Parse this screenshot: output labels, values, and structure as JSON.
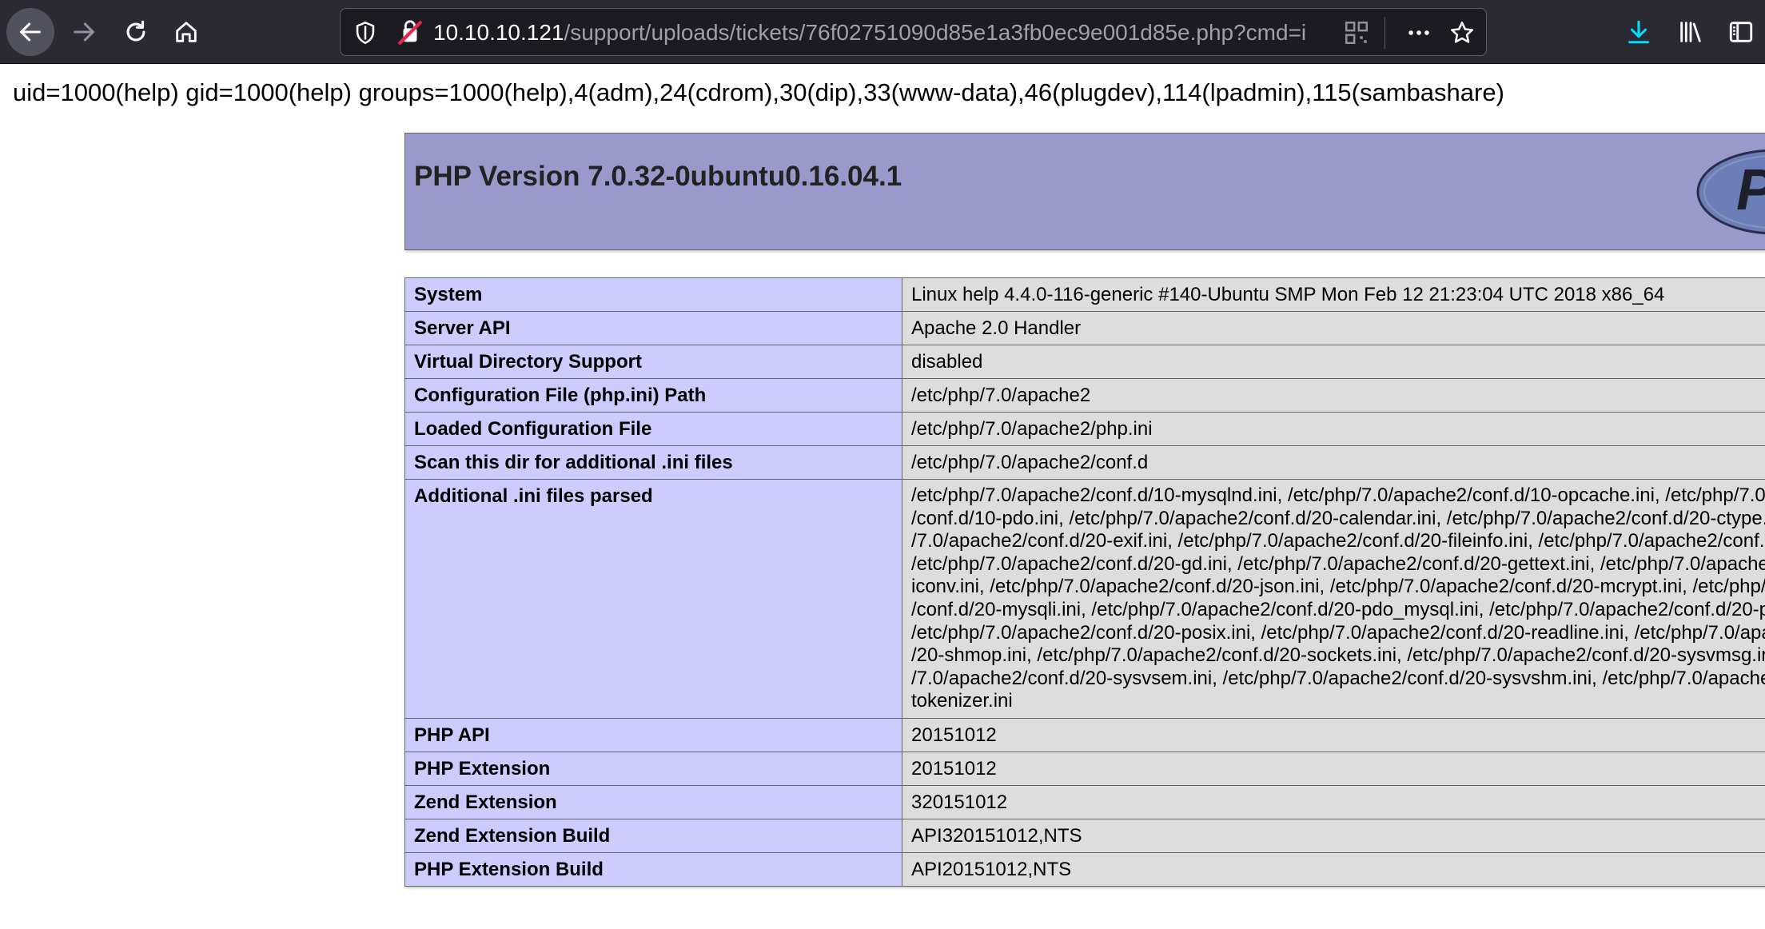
{
  "browser": {
    "url_host": "10.10.10.121",
    "url_path": "/support/uploads/tickets/76f02751090d85e1a3fb0ec9e001d85e.php?cmd=i"
  },
  "page": {
    "id_output": "uid=1000(help) gid=1000(help) groups=1000(help),4(adm),24(cdrom),30(dip),33(www-data),46(plugdev),114(lpadmin),115(sambashare)",
    "php_version_title": "PHP Version 7.0.32-0ubuntu0.16.04.1",
    "logo_text": "P"
  },
  "info_rows": [
    {
      "key": "System",
      "value": "Linux help 4.4.0-116-generic #140-Ubuntu SMP Mon Feb 12 21:23:04 UTC 2018 x86_64"
    },
    {
      "key": "Server API",
      "value": "Apache 2.0 Handler"
    },
    {
      "key": "Virtual Directory Support",
      "value": "disabled"
    },
    {
      "key": "Configuration File (php.ini) Path",
      "value": "/etc/php/7.0/apache2"
    },
    {
      "key": "Loaded Configuration File",
      "value": "/etc/php/7.0/apache2/php.ini"
    },
    {
      "key": "Scan this dir for additional .ini files",
      "value": "/etc/php/7.0/apache2/conf.d"
    },
    {
      "key": "Additional .ini files parsed",
      "lines": [
        "/etc/php/7.0/apache2/conf.d/10-mysqlnd.ini, /etc/php/7.0/apache2/conf.d/10-opcache.ini, /etc/php/7.0",
        "/conf.d/10-pdo.ini, /etc/php/7.0/apache2/conf.d/20-calendar.ini, /etc/php/7.0/apache2/conf.d/20-ctype.",
        "/7.0/apache2/conf.d/20-exif.ini, /etc/php/7.0/apache2/conf.d/20-fileinfo.ini, /etc/php/7.0/apache2/conf.",
        "/etc/php/7.0/apache2/conf.d/20-gd.ini, /etc/php/7.0/apache2/conf.d/20-gettext.ini, /etc/php/7.0/apache",
        "iconv.ini, /etc/php/7.0/apache2/conf.d/20-json.ini, /etc/php/7.0/apache2/conf.d/20-mcrypt.ini, /etc/php/",
        "/conf.d/20-mysqli.ini, /etc/php/7.0/apache2/conf.d/20-pdo_mysql.ini, /etc/php/7.0/apache2/conf.d/20-p",
        "/etc/php/7.0/apache2/conf.d/20-posix.ini, /etc/php/7.0/apache2/conf.d/20-readline.ini, /etc/php/7.0/apa",
        "/20-shmop.ini, /etc/php/7.0/apache2/conf.d/20-sockets.ini, /etc/php/7.0/apache2/conf.d/20-sysvmsg.in",
        "/7.0/apache2/conf.d/20-sysvsem.ini, /etc/php/7.0/apache2/conf.d/20-sysvshm.ini, /etc/php/7.0/apache",
        "tokenizer.ini"
      ]
    },
    {
      "key": "PHP API",
      "value": "20151012"
    },
    {
      "key": "PHP Extension",
      "value": "20151012"
    },
    {
      "key": "Zend Extension",
      "value": "320151012"
    },
    {
      "key": "Zend Extension Build",
      "value": "API320151012,NTS"
    },
    {
      "key": "PHP Extension Build",
      "value": "API20151012,NTS"
    }
  ]
}
